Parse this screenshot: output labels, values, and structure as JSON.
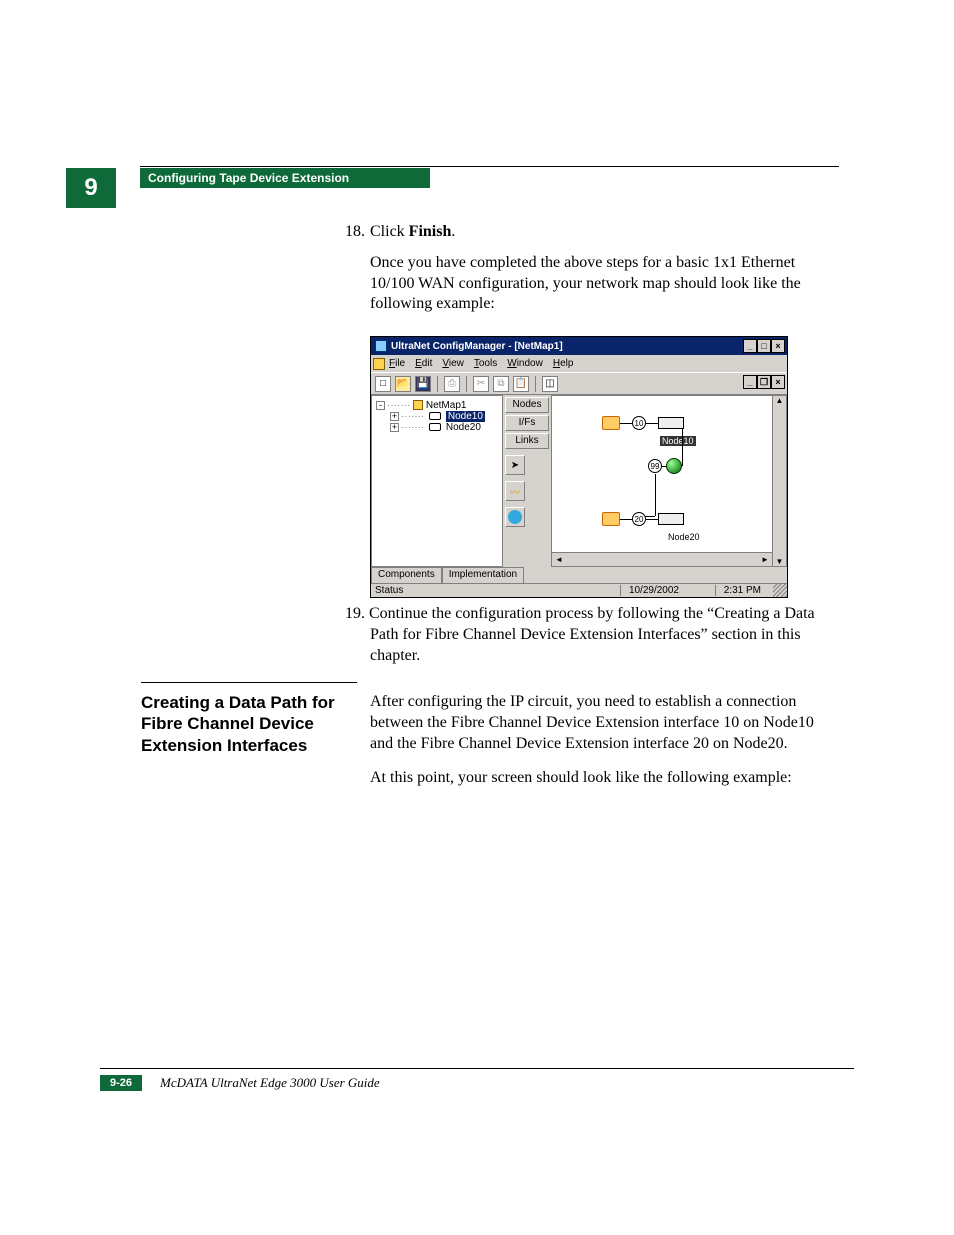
{
  "chapter_number": "9",
  "banner_title": "Configuring Tape Device Extension",
  "step18": {
    "number": "18.",
    "line1_prefix": "Click ",
    "line1_bold": "Finish",
    "line1_suffix": ".",
    "paragraph": "Once you have completed the above steps for a basic 1x1 Ethernet 10/100 WAN configuration, your network map should look like the following example:"
  },
  "screenshot": {
    "title": "UltraNet ConfigManager - [NetMap1]",
    "menus": [
      "File",
      "Edit",
      "View",
      "Tools",
      "Window",
      "Help"
    ],
    "tree": {
      "root": "NetMap1",
      "children": [
        {
          "label": "Node10",
          "selected": true
        },
        {
          "label": "Node20",
          "selected": false
        }
      ]
    },
    "side_buttons": [
      "Nodes",
      "I/Fs",
      "Links"
    ],
    "canvas": {
      "top_row": {
        "port": "10",
        "label": "Node10"
      },
      "middle_port": "99",
      "bottom_row": {
        "port": "20",
        "label": "Node20"
      }
    },
    "tabs": [
      "Components",
      "Implementation"
    ],
    "status_label": "Status",
    "status_date": "10/29/2002",
    "status_time": "2:31 PM"
  },
  "step19": {
    "number": "19.",
    "text": "Continue the configuration process by following the “Creating a Data Path for Fibre Channel Device Extension Interfaces” section in this chapter."
  },
  "section": {
    "heading": "Creating a Data Path for Fibre Channel Device Extension Interfaces",
    "p1": "After configuring the IP circuit, you need to establish a connection between the Fibre Channel Device Extension interface 10 on Node10 and the Fibre Channel Device Extension interface 20 on Node20.",
    "p2": "At this point, your screen should look like the following example:"
  },
  "footer": {
    "page": "9-26",
    "book_title": "McDATA UltraNet Edge 3000 User Guide"
  }
}
